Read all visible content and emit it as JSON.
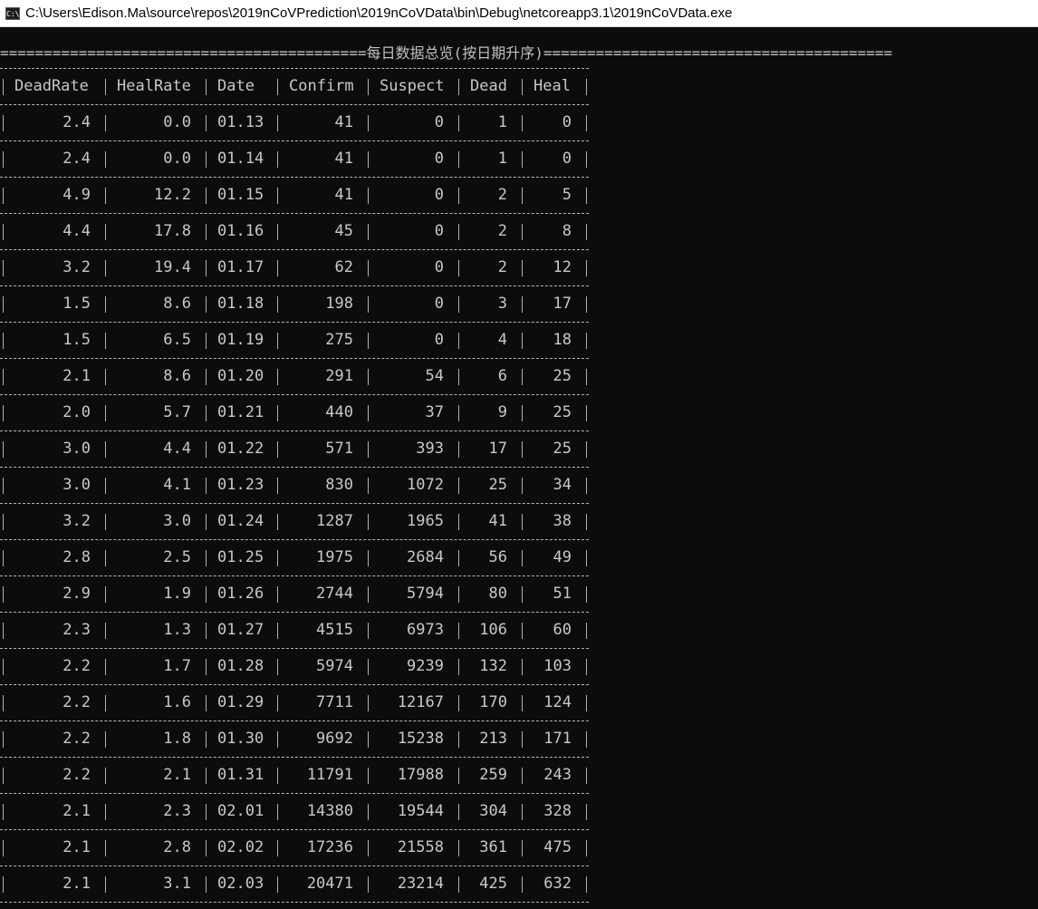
{
  "window": {
    "title": "C:\\Users\\Edison.Ma\\source\\repos\\2019nCoVPrediction\\2019nCoVData\\bin\\Debug\\netcoreapp3.1\\2019nCoVData.exe",
    "icon": "console-app-icon",
    "icon_text": "C:\\"
  },
  "console": {
    "banner": "==========================================每日数据总览(按日期升序)========================================",
    "columns": [
      "DeadRate",
      "HealRate",
      "Date",
      "Confirm",
      "Suspect",
      "Dead",
      "Heal"
    ],
    "rows": [
      [
        "2.4",
        "0.0",
        "01.13",
        "41",
        "0",
        "1",
        "0"
      ],
      [
        "2.4",
        "0.0",
        "01.14",
        "41",
        "0",
        "1",
        "0"
      ],
      [
        "4.9",
        "12.2",
        "01.15",
        "41",
        "0",
        "2",
        "5"
      ],
      [
        "4.4",
        "17.8",
        "01.16",
        "45",
        "0",
        "2",
        "8"
      ],
      [
        "3.2",
        "19.4",
        "01.17",
        "62",
        "0",
        "2",
        "12"
      ],
      [
        "1.5",
        "8.6",
        "01.18",
        "198",
        "0",
        "3",
        "17"
      ],
      [
        "1.5",
        "6.5",
        "01.19",
        "275",
        "0",
        "4",
        "18"
      ],
      [
        "2.1",
        "8.6",
        "01.20",
        "291",
        "54",
        "6",
        "25"
      ],
      [
        "2.0",
        "5.7",
        "01.21",
        "440",
        "37",
        "9",
        "25"
      ],
      [
        "3.0",
        "4.4",
        "01.22",
        "571",
        "393",
        "17",
        "25"
      ],
      [
        "3.0",
        "4.1",
        "01.23",
        "830",
        "1072",
        "25",
        "34"
      ],
      [
        "3.2",
        "3.0",
        "01.24",
        "1287",
        "1965",
        "41",
        "38"
      ],
      [
        "2.8",
        "2.5",
        "01.25",
        "1975",
        "2684",
        "56",
        "49"
      ],
      [
        "2.9",
        "1.9",
        "01.26",
        "2744",
        "5794",
        "80",
        "51"
      ],
      [
        "2.3",
        "1.3",
        "01.27",
        "4515",
        "6973",
        "106",
        "60"
      ],
      [
        "2.2",
        "1.7",
        "01.28",
        "5974",
        "9239",
        "132",
        "103"
      ],
      [
        "2.2",
        "1.6",
        "01.29",
        "7711",
        "12167",
        "170",
        "124"
      ],
      [
        "2.2",
        "1.8",
        "01.30",
        "9692",
        "15238",
        "213",
        "171"
      ],
      [
        "2.2",
        "2.1",
        "01.31",
        "11791",
        "17988",
        "259",
        "243"
      ],
      [
        "2.1",
        "2.3",
        "02.01",
        "14380",
        "19544",
        "304",
        "328"
      ],
      [
        "2.1",
        "2.8",
        "02.02",
        "17236",
        "21558",
        "361",
        "475"
      ],
      [
        "2.1",
        "3.1",
        "02.03",
        "20471",
        "23214",
        "425",
        "632"
      ]
    ]
  }
}
